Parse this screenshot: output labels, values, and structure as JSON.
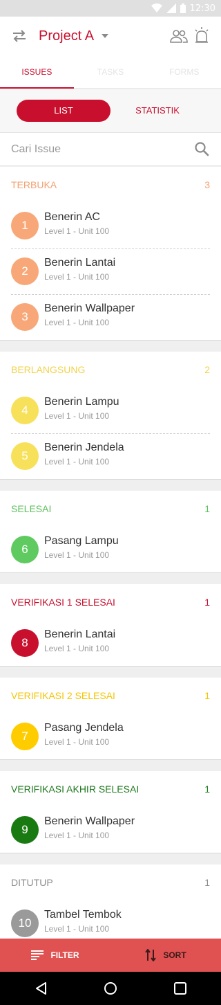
{
  "status_bar": {
    "time": "12:30"
  },
  "app_bar": {
    "project_title": "Project A"
  },
  "tabs": [
    {
      "label": "ISSUES",
      "active": true
    },
    {
      "label": "TASKS",
      "active": false
    },
    {
      "label": "FORMS",
      "active": false
    }
  ],
  "view_toggle": {
    "list_label": "LIST",
    "statistik_label": "STATISTIK"
  },
  "search": {
    "placeholder": "Cari Issue"
  },
  "sections": [
    {
      "title": "TERBUKA",
      "count": "3",
      "color": "#f4a070",
      "circle_color": "#f8a878",
      "issues": [
        {
          "num": "1",
          "title": "Benerin AC",
          "sub": "Level 1 - Unit 100"
        },
        {
          "num": "2",
          "title": "Benerin Lantai",
          "sub": "Level 1 - Unit 100"
        },
        {
          "num": "3",
          "title": "Benerin Wallpaper",
          "sub": "Level 1 - Unit 100"
        }
      ]
    },
    {
      "title": "BERLANGSUNG",
      "count": "2",
      "color": "#f2d24a",
      "circle_color": "#f7e15a",
      "issues": [
        {
          "num": "4",
          "title": "Benerin Lampu",
          "sub": "Level 1 - Unit 100"
        },
        {
          "num": "5",
          "title": "Benerin Jendela",
          "sub": "Level 1 - Unit 100"
        }
      ]
    },
    {
      "title": "SELESAI",
      "count": "1",
      "color": "#5cbf5c",
      "circle_color": "#5fca5f",
      "issues": [
        {
          "num": "6",
          "title": "Pasang Lampu",
          "sub": "Level 1 - Unit 100"
        }
      ]
    },
    {
      "title": "VERIFIKASI 1 SELESAI",
      "count": "1",
      "color": "#c8102e",
      "circle_color": "#c8102e",
      "issues": [
        {
          "num": "8",
          "title": "Benerin Lantai",
          "sub": "Level 1 - Unit 100"
        }
      ]
    },
    {
      "title": "VERIFIKASI 2 SELESAI",
      "count": "1",
      "color": "#f5c400",
      "circle_color": "#ffcc00",
      "issues": [
        {
          "num": "7",
          "title": "Pasang Jendela",
          "sub": "Level 1 - Unit 100"
        }
      ]
    },
    {
      "title": "VERIFIKASI AKHIR SELESAI",
      "count": "1",
      "color": "#1f7a1f",
      "circle_color": "#1a7a12",
      "issues": [
        {
          "num": "9",
          "title": "Benerin Wallpaper",
          "sub": "Level 1 - Unit 100"
        }
      ]
    },
    {
      "title": "DITUTUP",
      "count": "1",
      "color": "#8c8c8c",
      "circle_color": "#9a9a9a",
      "issues": [
        {
          "num": "10",
          "title": "Tambel Tembok",
          "sub": "Level 1 - Unit 100"
        }
      ]
    }
  ],
  "bottom_bar": {
    "filter_label": "FILTER",
    "sort_label": "SORT"
  },
  "icons": {
    "swap": "swap-icon",
    "caret": "caret-down-icon",
    "people": "people-icon",
    "alarm": "alarm-icon",
    "search": "search-icon",
    "filter": "filter-icon",
    "sort": "sort-icon",
    "back": "back-icon",
    "home": "home-icon",
    "recent": "recent-apps-icon"
  }
}
